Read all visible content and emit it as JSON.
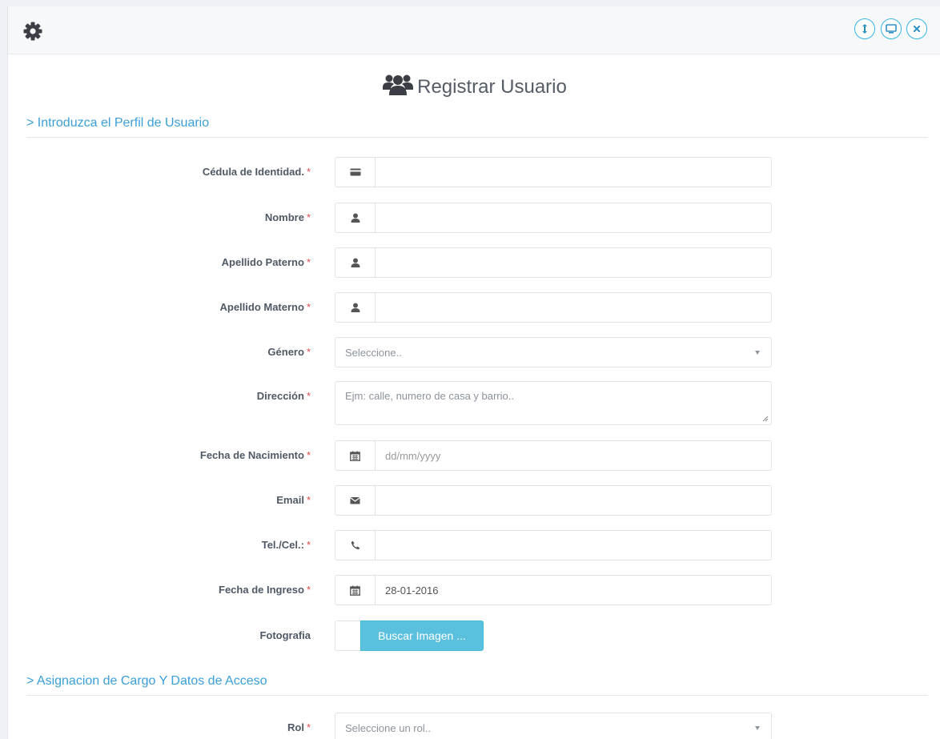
{
  "header": {
    "settings_icon": "gear-icon",
    "buttons": [
      {
        "name": "collapse-button",
        "icon": "vertical-arrows-icon"
      },
      {
        "name": "fullscreen-button",
        "icon": "monitor-icon"
      },
      {
        "name": "close-button",
        "icon": "close-icon"
      }
    ],
    "accent_color": "#36b6e6"
  },
  "page": {
    "title": "Registrar Usuario",
    "title_icon": "users-icon"
  },
  "sections": {
    "profile": "> Introduzca el Perfil de Usuario",
    "access": "> Asignacion de Cargo Y Datos de Acceso"
  },
  "form": {
    "required_mark": "*",
    "cedula": {
      "label": "Cédula de Identidad.",
      "value": "",
      "icon": "id-card-icon"
    },
    "nombre": {
      "label": "Nombre",
      "value": "",
      "icon": "user-icon"
    },
    "apellido_paterno": {
      "label": "Apellido Paterno",
      "value": "",
      "icon": "user-icon"
    },
    "apellido_materno": {
      "label": "Apellido Materno",
      "value": "",
      "icon": "user-icon"
    },
    "genero": {
      "label": "Género",
      "placeholder": "Seleccione.."
    },
    "direccion": {
      "label": "Dirección",
      "placeholder": "Ejm: calle, numero de casa y barrio.."
    },
    "fecha_nacimiento": {
      "label": "Fecha de Nacimiento",
      "placeholder": "dd/mm/yyyy",
      "icon": "calendar-icon"
    },
    "email": {
      "label": "Email",
      "value": "",
      "icon": "envelope-icon"
    },
    "telefono": {
      "label": "Tel./Cel.:",
      "value": "",
      "icon": "phone-icon"
    },
    "fecha_ingreso": {
      "label": "Fecha de Ingreso",
      "value": "28-01-2016",
      "icon": "calendar-icon"
    },
    "fotografia": {
      "label": "Fotografia",
      "button": "Buscar Imagen ..."
    },
    "rol": {
      "label": "Rol",
      "placeholder": "Seleccione un rol.."
    }
  },
  "colors": {
    "section_title": "#3a9fd8",
    "required": "#e04b4b",
    "file_button": "#5bc0de"
  }
}
